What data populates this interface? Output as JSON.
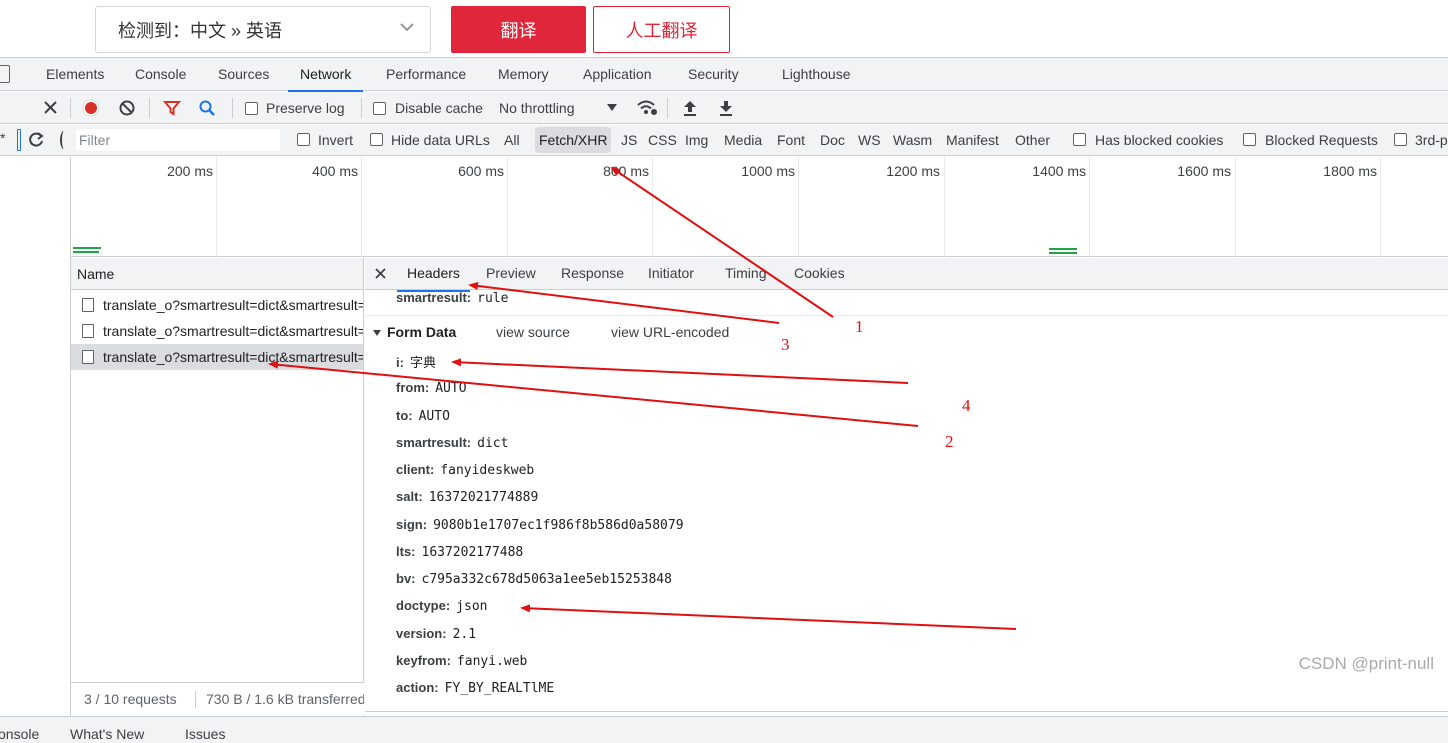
{
  "page": {
    "lang_select": "检测到：中文 » 英语",
    "translate_button": "翻译",
    "human_translate_button": "人工翻译"
  },
  "devtools": {
    "tabs": [
      "Elements",
      "Console",
      "Sources",
      "Network",
      "Performance",
      "Memory",
      "Application",
      "Security",
      "Lighthouse"
    ],
    "active_tab": "Network",
    "toolbar": {
      "preserve_log": "Preserve log",
      "disable_cache": "Disable cache",
      "throttling": "No throttling"
    },
    "filter": {
      "placeholder": "Filter",
      "invert": "Invert",
      "hide_data_urls": "Hide data URLs",
      "types": [
        "All",
        "Fetch/XHR",
        "JS",
        "CSS",
        "Img",
        "Media",
        "Font",
        "Doc",
        "WS",
        "Wasm",
        "Manifest",
        "Other"
      ],
      "active_type": "Fetch/XHR",
      "has_blocked_cookies": "Has blocked cookies",
      "blocked_requests": "Blocked Requests",
      "third_party": "3rd-p"
    },
    "overview_ticks": [
      "200 ms",
      "400 ms",
      "600 ms",
      "800 ms",
      "1000 ms",
      "1200 ms",
      "1400 ms",
      "1600 ms",
      "1800 ms"
    ],
    "requests": {
      "header": "Name",
      "rows": [
        "translate_o?smartresult=dict&smartresult=rule",
        "translate_o?smartresult=dict&smartresult=rule",
        "translate_o?smartresult=dict&smartresult=rule"
      ],
      "selected_index": 2,
      "status_count": "3 / 10 requests",
      "status_transfer": "730 B / 1.6 kB transferred"
    },
    "details": {
      "tabs": [
        "Headers",
        "Preview",
        "Response",
        "Initiator",
        "Timing",
        "Cookies"
      ],
      "active_tab": "Headers",
      "partial_key": "smartresult:",
      "partial_value": "rule",
      "form_data_title": "Form Data",
      "view_source": "view source",
      "view_url_encoded": "view URL-encoded",
      "form_fields": [
        {
          "key": "i:",
          "value": "字典"
        },
        {
          "key": "from:",
          "value": "AUTO"
        },
        {
          "key": "to:",
          "value": "AUTO"
        },
        {
          "key": "smartresult:",
          "value": "dict"
        },
        {
          "key": "client:",
          "value": "fanyideskweb"
        },
        {
          "key": "salt:",
          "value": "16372021774889"
        },
        {
          "key": "sign:",
          "value": "9080b1e1707ec1f986f8b586d0a58079"
        },
        {
          "key": "lts:",
          "value": "1637202177488"
        },
        {
          "key": "bv:",
          "value": "c795a332c678d5063a1ee5eb15253848"
        },
        {
          "key": "doctype:",
          "value": "json"
        },
        {
          "key": "version:",
          "value": "2.1"
        },
        {
          "key": "keyfrom:",
          "value": "fanyi.web"
        },
        {
          "key": "action:",
          "value": "FY_BY_REALTlME"
        }
      ]
    },
    "drawer_tabs": [
      "onsole",
      "What's New",
      "Issues"
    ]
  },
  "annotations": [
    "1",
    "2",
    "3",
    "4"
  ],
  "watermark": "CSDN @print-null",
  "colors": {
    "accent": "#1a73e8",
    "record": "#d93025",
    "brand_red": "#e0263a",
    "annotation": "#e01010",
    "waterfall": "#1ea446"
  }
}
